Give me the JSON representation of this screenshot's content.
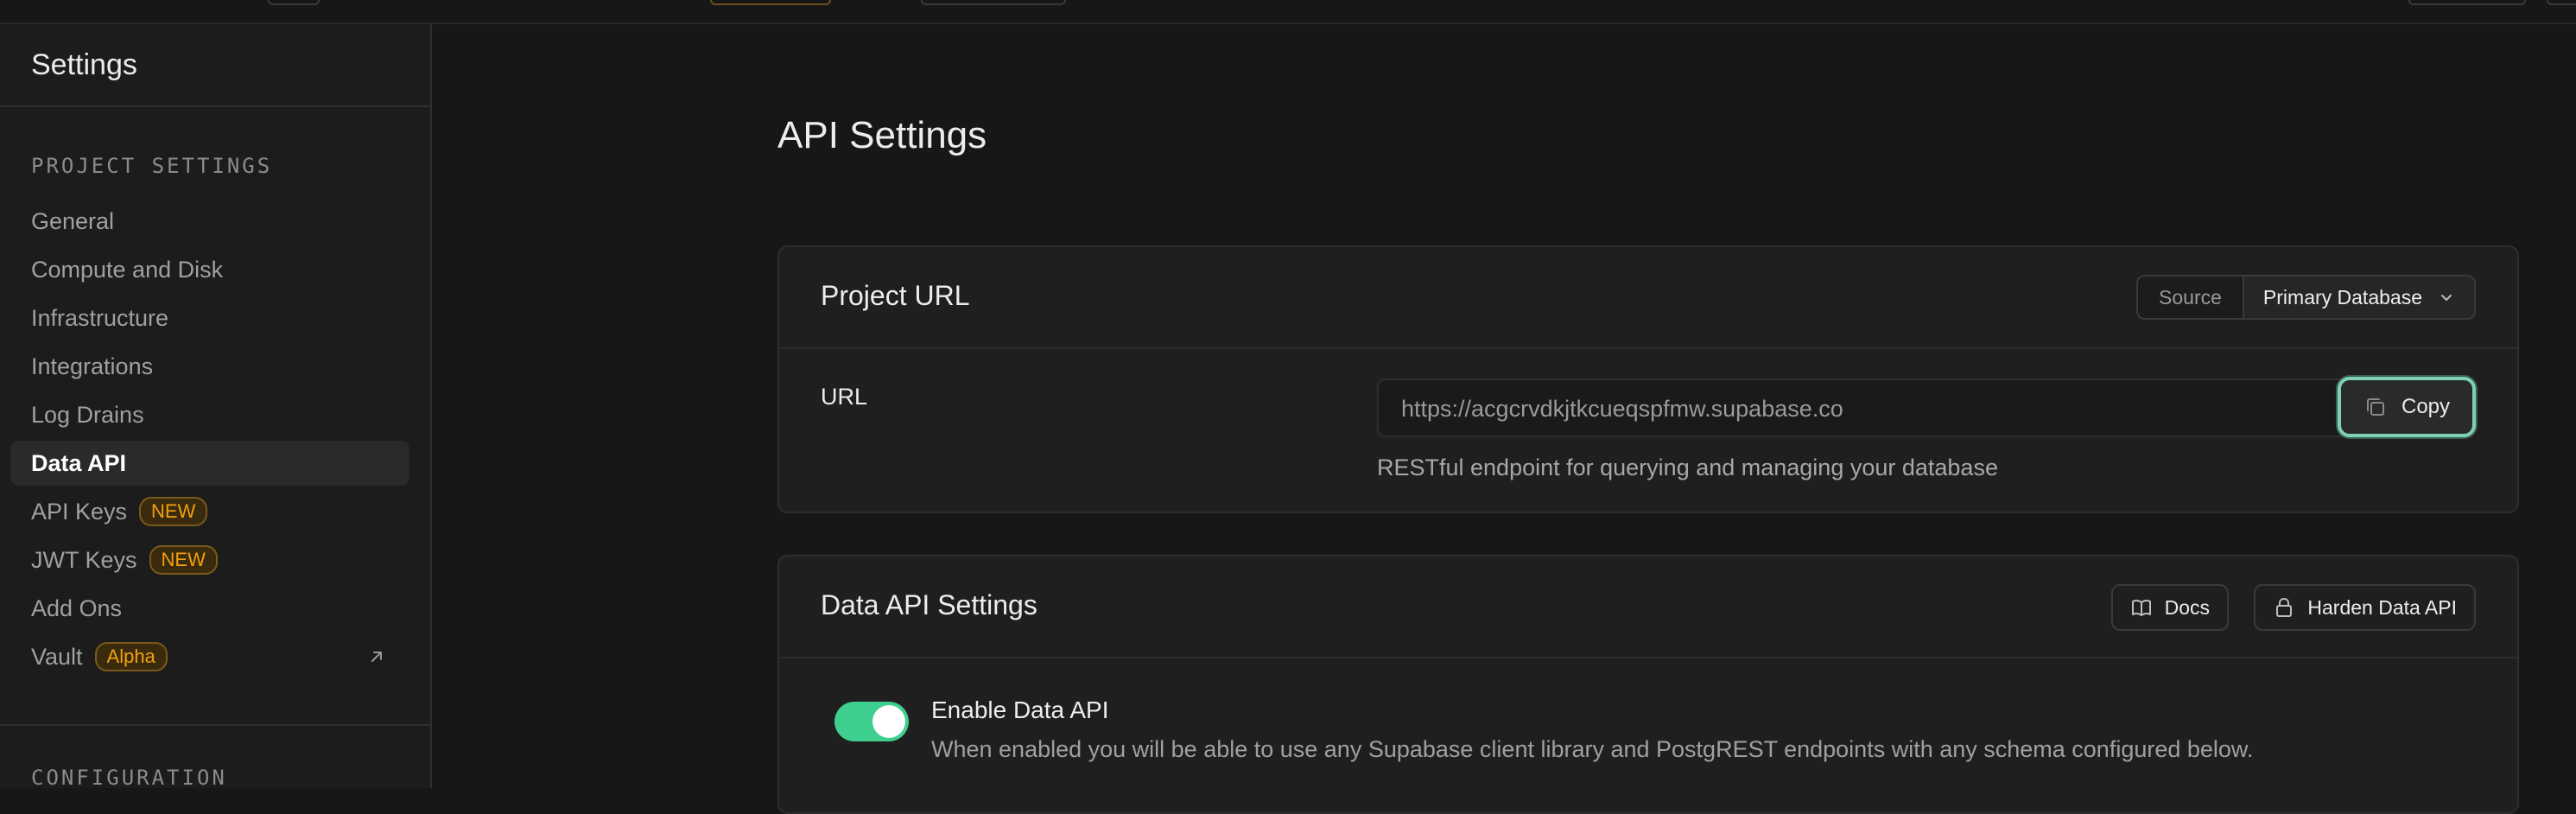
{
  "sidebar": {
    "title": "Settings",
    "section_project": "PROJECT SETTINGS",
    "items": [
      {
        "label": "General"
      },
      {
        "label": "Compute and Disk"
      },
      {
        "label": "Infrastructure"
      },
      {
        "label": "Integrations"
      },
      {
        "label": "Log Drains"
      },
      {
        "label": "Data API",
        "active": true
      },
      {
        "label": "API Keys",
        "badge": "NEW"
      },
      {
        "label": "JWT Keys",
        "badge": "NEW"
      },
      {
        "label": "Add Ons"
      },
      {
        "label": "Vault",
        "badge": "Alpha",
        "icon": "external-link-icon"
      }
    ],
    "section_config": "CONFIGURATION"
  },
  "main": {
    "title": "API Settings",
    "project_url_card": {
      "title": "Project URL",
      "source_label": "Source",
      "source_value": "Primary Database",
      "url_label": "URL",
      "url_value": "https://acgcrvdkjtkcueqspfmw.supabase.co",
      "copy_label": "Copy",
      "help_text": "RESTful endpoint for querying and managing your database"
    },
    "data_api_card": {
      "title": "Data API Settings",
      "docs_label": "Docs",
      "harden_label": "Harden Data API",
      "enable_title": "Enable Data API",
      "enable_desc": "When enabled you will be able to use any Supabase client library and PostgREST endpoints with any schema configured below.",
      "enabled": true
    }
  },
  "colors": {
    "background": "#171717",
    "sidebar_bg": "#1c1c1c",
    "card_bg": "#1f1f1f",
    "accent_green": "#3ecf8e",
    "focus_ring": "#7fd1b4",
    "badge_orange": "#f1a10d"
  }
}
